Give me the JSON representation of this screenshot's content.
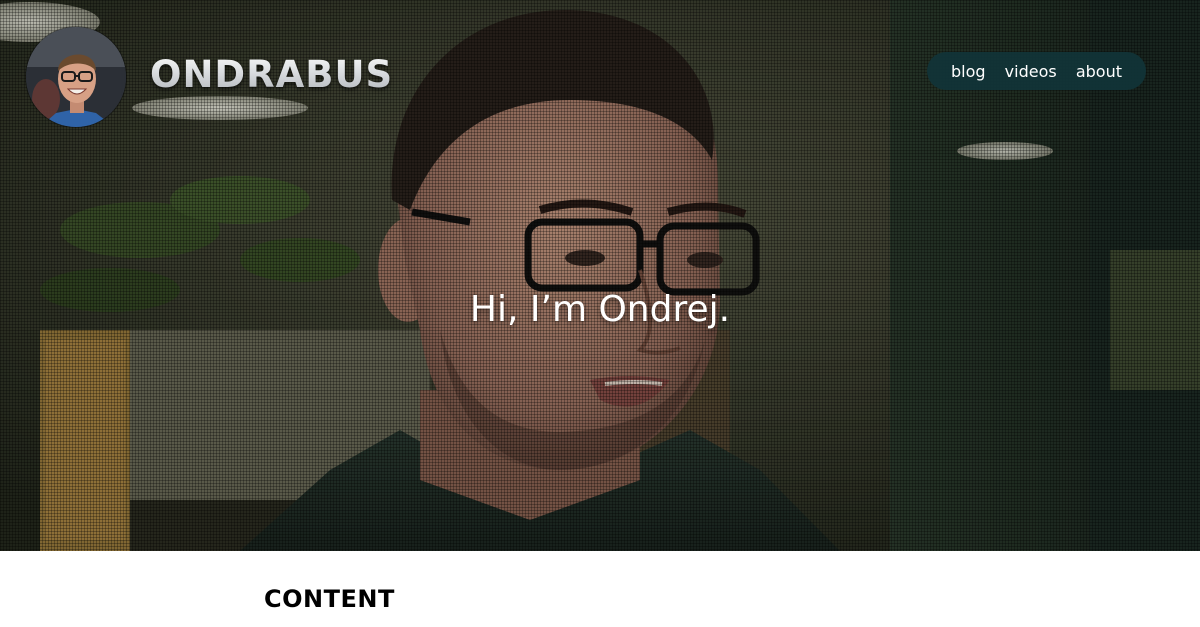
{
  "header": {
    "logo_text": "ONDRABUS"
  },
  "nav": {
    "items": [
      {
        "label": "blog"
      },
      {
        "label": "videos"
      },
      {
        "label": "about"
      }
    ]
  },
  "hero": {
    "greeting": "Hi, I’m Ondrej."
  },
  "content": {
    "heading": "CONTENT"
  },
  "colors": {
    "nav_background": "#113438",
    "text_light": "#ffffff",
    "heading_dark": "#000000"
  }
}
